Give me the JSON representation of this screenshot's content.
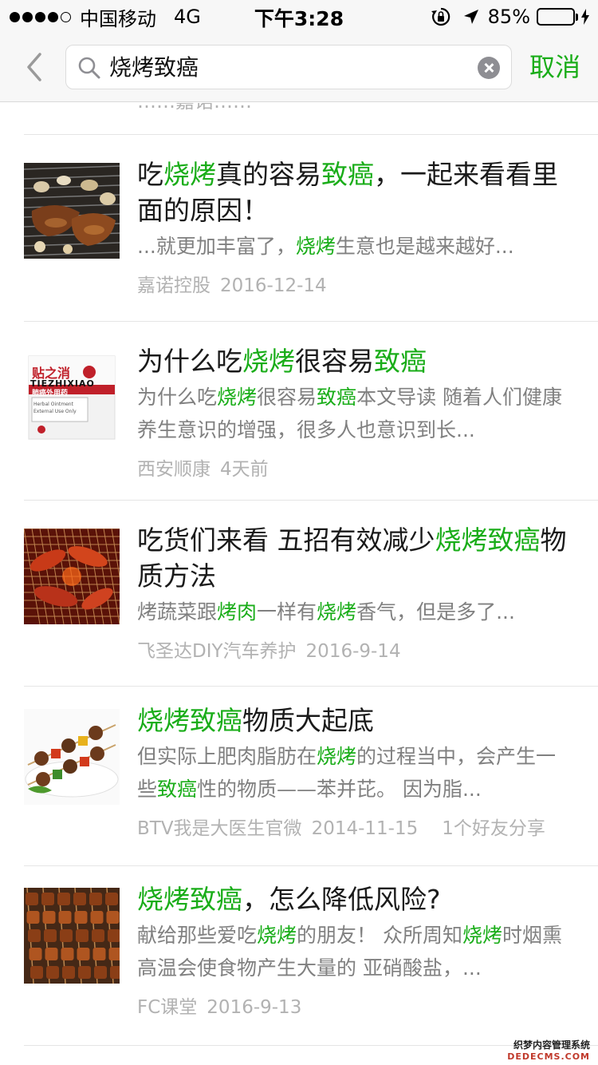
{
  "status_bar": {
    "carrier": "中国移动",
    "network": "4G",
    "time": "下午3:28",
    "battery": "85%",
    "battery_level": 0.85
  },
  "search": {
    "query": "烧烤致癌",
    "cancel_label": "取消"
  },
  "partial_row_text": "……嘉诺……",
  "results": [
    {
      "title": [
        "吃",
        {
          "hl": "烧烤"
        },
        "真的容易",
        {
          "hl": "致癌"
        },
        "，一起来看看里面的原因！"
      ],
      "snippet": [
        "...就更加丰富了，",
        {
          "hl": "烧烤"
        },
        "生意也是越来越好..."
      ],
      "source": "嘉诺控股",
      "date": "2016-12-14",
      "extra": "",
      "thumb": "grill"
    },
    {
      "title": [
        "为什么吃",
        {
          "hl": "烧烤"
        },
        "很容易",
        {
          "hl": "致癌"
        }
      ],
      "snippet": [
        "为什么吃",
        {
          "hl": "烧烤"
        },
        "很容易",
        {
          "hl": "致癌"
        },
        "本文导读 随着人们健康养生意识的增强，很多人也意识到长..."
      ],
      "source": "西安顺康",
      "date": "4天前",
      "extra": "",
      "thumb": "box",
      "thumb_text": {
        "brand": "贴之消",
        "pinyin": "TIEZHIXIAO",
        "red": "肺癌外用药",
        "small": "Herbal Ointment External Use Only"
      }
    },
    {
      "title": [
        "吃货们来看 五招有效减少",
        {
          "hl": "烧烤致癌"
        },
        "物质方法"
      ],
      "snippet": [
        "烤蔬菜跟",
        {
          "hl": "烤肉"
        },
        "一样有",
        {
          "hl": "烧烤"
        },
        "香气，但是多了..."
      ],
      "source": "飞圣达DIY汽车养护",
      "date": "2016-9-14",
      "extra": "",
      "thumb": "crayfish"
    },
    {
      "title": [
        {
          "hl": "烧烤致癌"
        },
        "物质大起底"
      ],
      "snippet": [
        "但实际上肥肉脂肪在",
        {
          "hl": "烧烤"
        },
        "的过程当中，会产生一些",
        {
          "hl": "致癌"
        },
        "性的物质——苯并芘。 因为脂..."
      ],
      "source": "BTV我是大医生官微",
      "date": "2014-11-15",
      "extra": "1个好友分享",
      "thumb": "kebab"
    },
    {
      "title": [
        {
          "hl": "烧烤致癌"
        },
        "，怎么降低风险?"
      ],
      "snippet": [
        "献给那些爱吃",
        {
          "hl": "烧烤"
        },
        "的朋友！ 众所周知",
        {
          "hl": "烧烤"
        },
        "时烟熏高温会使食物产生大量的 亚硝酸盐，..."
      ],
      "source": "FC课堂",
      "date": "2016-9-13",
      "extra": "",
      "thumb": "skewers"
    }
  ],
  "watermark": {
    "cn": "织梦内容管理系统",
    "en": "DEDECMS.COM"
  },
  "colors": {
    "highlight": "#1aad19",
    "title": "#1a1a1a",
    "snippet": "#808080",
    "meta": "#b2b2b2",
    "battery": "#4cd964"
  }
}
